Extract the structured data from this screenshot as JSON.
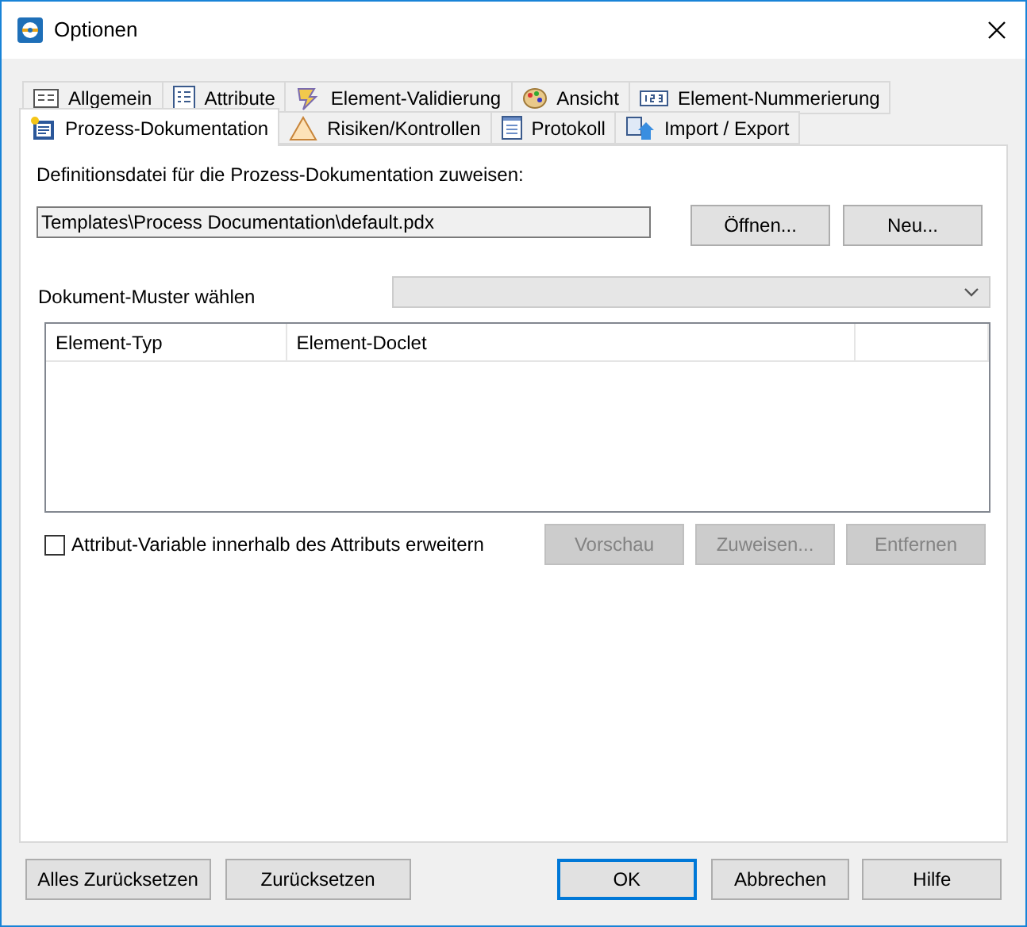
{
  "window": {
    "title": "Optionen"
  },
  "tab_rows": [
    [
      {
        "label": "Allgemein",
        "selected": false
      },
      {
        "label": "Attribute",
        "selected": false
      },
      {
        "label": "Element-Validierung",
        "selected": false
      },
      {
        "label": "Ansicht",
        "selected": false
      },
      {
        "label": "Element-Nummerierung",
        "selected": false
      }
    ],
    [
      {
        "label": "Prozess-Dokumentation",
        "selected": true
      },
      {
        "label": "Risiken/Kontrollen",
        "selected": false
      },
      {
        "label": "Protokoll",
        "selected": false
      },
      {
        "label": "Import / Export",
        "selected": false
      }
    ]
  ],
  "definition": {
    "label": "Definitionsdatei für die Prozess-Dokumentation zuweisen:",
    "value": "Templates\\Process Documentation\\default.pdx",
    "buttons": [
      {
        "label": "Öffnen...",
        "disabled": false
      },
      {
        "label": "Neu...",
        "disabled": false
      }
    ]
  },
  "template": {
    "label": "Dokument-Muster wählen",
    "disabled": true
  },
  "table": {
    "columns": [
      "Element-Typ",
      "Element-Doclet"
    ]
  },
  "expand_checkbox": {
    "label": "Attribut-Variable innerhalb des Attributs erweitern",
    "checked": false
  },
  "table_buttons": [
    {
      "label": "Vorschau",
      "disabled": true
    },
    {
      "label": "Zuweisen...",
      "disabled": true
    },
    {
      "label": "Entfernen",
      "disabled": true
    }
  ],
  "footer_buttons": [
    {
      "label": "Alles Zurücksetzen",
      "default": false
    },
    {
      "label": "Zurücksetzen",
      "default": false
    },
    {
      "label": "OK",
      "default": true
    },
    {
      "label": "Abbrechen",
      "default": false
    },
    {
      "label": "Hilfe",
      "default": false
    }
  ]
}
